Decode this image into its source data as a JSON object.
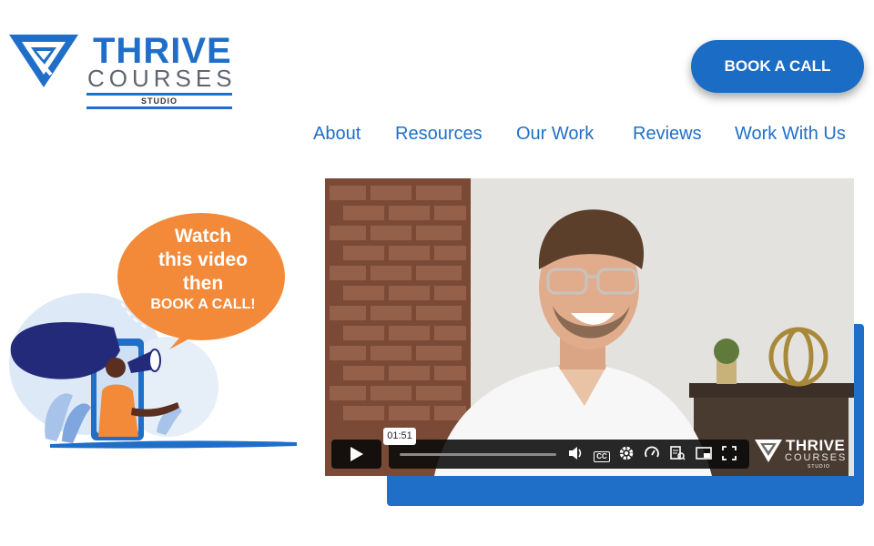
{
  "logo": {
    "line1": "THRIVE",
    "line2": "COURSES",
    "line3": "STUDIO"
  },
  "header": {
    "cta_label": "BOOK A CALL"
  },
  "nav": {
    "items": [
      {
        "label": "About"
      },
      {
        "label": "Resources"
      },
      {
        "label": "Our Work"
      },
      {
        "label": "Reviews"
      },
      {
        "label": "Work With Us"
      }
    ]
  },
  "promo": {
    "bubble_line1": "Watch",
    "bubble_line2": "this video",
    "bubble_line3": "then",
    "bubble_line4": "BOOK A CALL!"
  },
  "video": {
    "hover_time": "01:51",
    "progress_fraction": 0.0,
    "watermark_line1": "THRIVE",
    "watermark_line2": "COURSES",
    "watermark_line3": "STUDIO",
    "controls": [
      "play-icon",
      "volume-icon",
      "captions-icon",
      "settings-icon",
      "speed-icon",
      "transcript-icon",
      "picture-in-picture-icon",
      "fullscreen-icon"
    ]
  },
  "colors": {
    "brand_blue": "#1f6fc9",
    "cta_blue": "#1b6cc4",
    "bubble_orange": "#f28a3a",
    "logo_gray": "#5f6670"
  }
}
